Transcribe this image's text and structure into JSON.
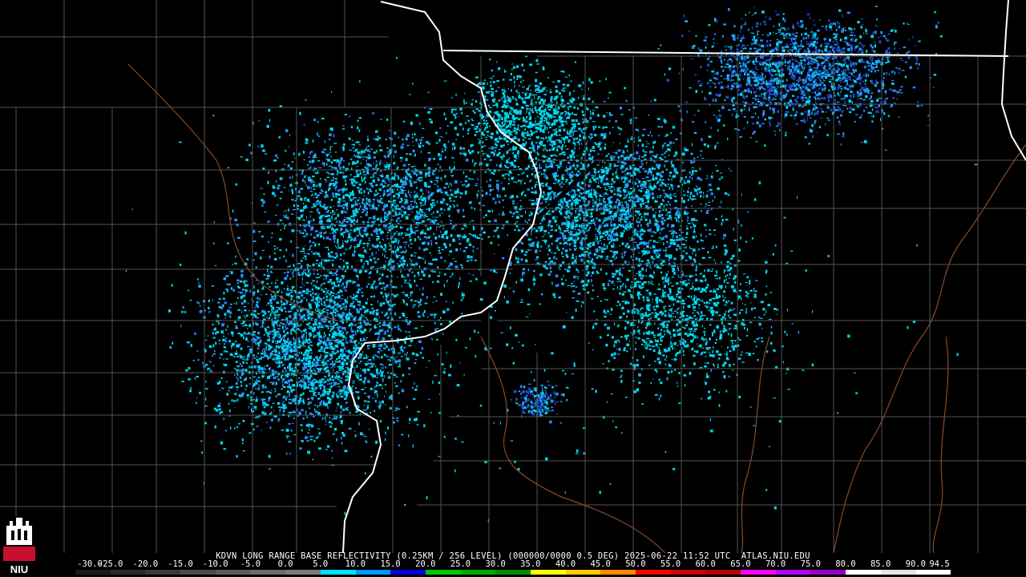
{
  "caption": "KDVN LONG RANGE BASE REFLECTIVITY (0.25KM / 256 LEVEL) (000000/0000 0.5 DEG) 2025-06-22 11:52 UTC  ATLAS.NIU.EDU",
  "scale": {
    "labels": [
      "-30.0",
      "-25.0",
      "-20.0",
      "-15.0",
      "-10.0",
      "-5.0",
      "0.0",
      "5.0",
      "10.0",
      "15.0",
      "20.0",
      "25.0",
      "30.0",
      "35.0",
      "40.0",
      "45.0",
      "50.0",
      "55.0",
      "60.0",
      "65.0",
      "70.0",
      "75.0",
      "80.0",
      "85.0",
      "90.0",
      "94.5"
    ],
    "colors": [
      "#1a1a1a",
      "#2a2a2a",
      "#3a3a3a",
      "#4a4a4a",
      "#5a5a5a",
      "#6a6a6a",
      "#7a7a7a",
      "#00e0ff",
      "#0096ff",
      "#0000dc",
      "#00c800",
      "#00aa00",
      "#008c00",
      "#ffff00",
      "#ffc800",
      "#ff8c00",
      "#ff0000",
      "#d20000",
      "#b40000",
      "#ff00ff",
      "#b400ff",
      "#9600c8",
      "#ffffff",
      "#e6e6e6",
      "#ffffff"
    ]
  },
  "logo": {
    "text": "NIU",
    "color": "#c8102e"
  },
  "map_colors": {
    "background": "#000000",
    "county_lines": "#555555",
    "state_lines": "#ffffff",
    "rivers": "#8b4a2a",
    "echo_light": "#00d7f0",
    "echo_mid": "#2a8cff",
    "echo_dark": "#1e46c8"
  }
}
